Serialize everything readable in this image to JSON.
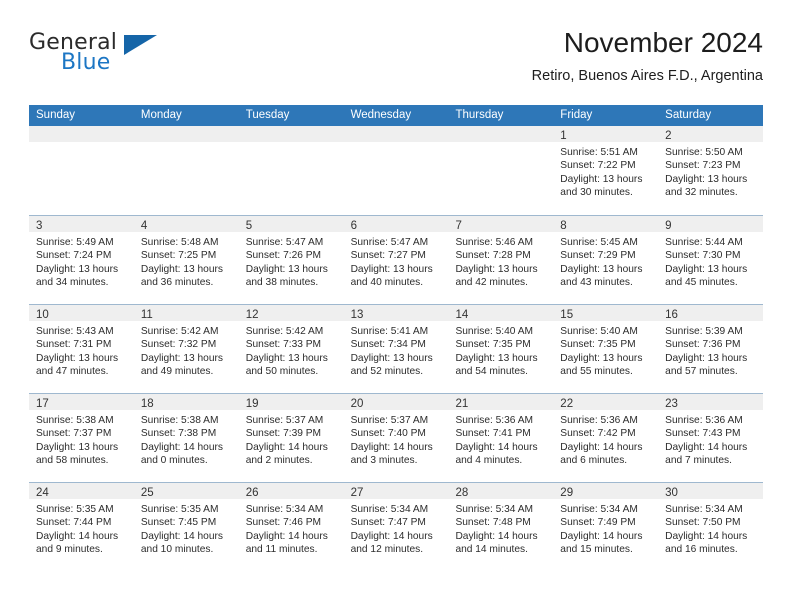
{
  "brand": {
    "name_top": "General",
    "name_bottom": "Blue",
    "accent_color": "#1c76c4",
    "triangle_color": "#1565a8"
  },
  "header": {
    "title": "November 2024",
    "subtitle": "Retiro, Buenos Aires F.D., Argentina"
  },
  "calendar": {
    "header_bg": "#2e77b8",
    "daynum_bg": "#efefef",
    "weekdays": [
      "Sunday",
      "Monday",
      "Tuesday",
      "Wednesday",
      "Thursday",
      "Friday",
      "Saturday"
    ],
    "weeks": [
      [
        {
          "day": "",
          "empty": true
        },
        {
          "day": "",
          "empty": true
        },
        {
          "day": "",
          "empty": true
        },
        {
          "day": "",
          "empty": true
        },
        {
          "day": "",
          "empty": true
        },
        {
          "day": "1",
          "sunrise": "Sunrise: 5:51 AM",
          "sunset": "Sunset: 7:22 PM",
          "daylight1": "Daylight: 13 hours",
          "daylight2": "and 30 minutes."
        },
        {
          "day": "2",
          "sunrise": "Sunrise: 5:50 AM",
          "sunset": "Sunset: 7:23 PM",
          "daylight1": "Daylight: 13 hours",
          "daylight2": "and 32 minutes."
        }
      ],
      [
        {
          "day": "3",
          "sunrise": "Sunrise: 5:49 AM",
          "sunset": "Sunset: 7:24 PM",
          "daylight1": "Daylight: 13 hours",
          "daylight2": "and 34 minutes."
        },
        {
          "day": "4",
          "sunrise": "Sunrise: 5:48 AM",
          "sunset": "Sunset: 7:25 PM",
          "daylight1": "Daylight: 13 hours",
          "daylight2": "and 36 minutes."
        },
        {
          "day": "5",
          "sunrise": "Sunrise: 5:47 AM",
          "sunset": "Sunset: 7:26 PM",
          "daylight1": "Daylight: 13 hours",
          "daylight2": "and 38 minutes."
        },
        {
          "day": "6",
          "sunrise": "Sunrise: 5:47 AM",
          "sunset": "Sunset: 7:27 PM",
          "daylight1": "Daylight: 13 hours",
          "daylight2": "and 40 minutes."
        },
        {
          "day": "7",
          "sunrise": "Sunrise: 5:46 AM",
          "sunset": "Sunset: 7:28 PM",
          "daylight1": "Daylight: 13 hours",
          "daylight2": "and 42 minutes."
        },
        {
          "day": "8",
          "sunrise": "Sunrise: 5:45 AM",
          "sunset": "Sunset: 7:29 PM",
          "daylight1": "Daylight: 13 hours",
          "daylight2": "and 43 minutes."
        },
        {
          "day": "9",
          "sunrise": "Sunrise: 5:44 AM",
          "sunset": "Sunset: 7:30 PM",
          "daylight1": "Daylight: 13 hours",
          "daylight2": "and 45 minutes."
        }
      ],
      [
        {
          "day": "10",
          "sunrise": "Sunrise: 5:43 AM",
          "sunset": "Sunset: 7:31 PM",
          "daylight1": "Daylight: 13 hours",
          "daylight2": "and 47 minutes."
        },
        {
          "day": "11",
          "sunrise": "Sunrise: 5:42 AM",
          "sunset": "Sunset: 7:32 PM",
          "daylight1": "Daylight: 13 hours",
          "daylight2": "and 49 minutes."
        },
        {
          "day": "12",
          "sunrise": "Sunrise: 5:42 AM",
          "sunset": "Sunset: 7:33 PM",
          "daylight1": "Daylight: 13 hours",
          "daylight2": "and 50 minutes."
        },
        {
          "day": "13",
          "sunrise": "Sunrise: 5:41 AM",
          "sunset": "Sunset: 7:34 PM",
          "daylight1": "Daylight: 13 hours",
          "daylight2": "and 52 minutes."
        },
        {
          "day": "14",
          "sunrise": "Sunrise: 5:40 AM",
          "sunset": "Sunset: 7:35 PM",
          "daylight1": "Daylight: 13 hours",
          "daylight2": "and 54 minutes."
        },
        {
          "day": "15",
          "sunrise": "Sunrise: 5:40 AM",
          "sunset": "Sunset: 7:35 PM",
          "daylight1": "Daylight: 13 hours",
          "daylight2": "and 55 minutes."
        },
        {
          "day": "16",
          "sunrise": "Sunrise: 5:39 AM",
          "sunset": "Sunset: 7:36 PM",
          "daylight1": "Daylight: 13 hours",
          "daylight2": "and 57 minutes."
        }
      ],
      [
        {
          "day": "17",
          "sunrise": "Sunrise: 5:38 AM",
          "sunset": "Sunset: 7:37 PM",
          "daylight1": "Daylight: 13 hours",
          "daylight2": "and 58 minutes."
        },
        {
          "day": "18",
          "sunrise": "Sunrise: 5:38 AM",
          "sunset": "Sunset: 7:38 PM",
          "daylight1": "Daylight: 14 hours",
          "daylight2": "and 0 minutes."
        },
        {
          "day": "19",
          "sunrise": "Sunrise: 5:37 AM",
          "sunset": "Sunset: 7:39 PM",
          "daylight1": "Daylight: 14 hours",
          "daylight2": "and 2 minutes."
        },
        {
          "day": "20",
          "sunrise": "Sunrise: 5:37 AM",
          "sunset": "Sunset: 7:40 PM",
          "daylight1": "Daylight: 14 hours",
          "daylight2": "and 3 minutes."
        },
        {
          "day": "21",
          "sunrise": "Sunrise: 5:36 AM",
          "sunset": "Sunset: 7:41 PM",
          "daylight1": "Daylight: 14 hours",
          "daylight2": "and 4 minutes."
        },
        {
          "day": "22",
          "sunrise": "Sunrise: 5:36 AM",
          "sunset": "Sunset: 7:42 PM",
          "daylight1": "Daylight: 14 hours",
          "daylight2": "and 6 minutes."
        },
        {
          "day": "23",
          "sunrise": "Sunrise: 5:36 AM",
          "sunset": "Sunset: 7:43 PM",
          "daylight1": "Daylight: 14 hours",
          "daylight2": "and 7 minutes."
        }
      ],
      [
        {
          "day": "24",
          "sunrise": "Sunrise: 5:35 AM",
          "sunset": "Sunset: 7:44 PM",
          "daylight1": "Daylight: 14 hours",
          "daylight2": "and 9 minutes."
        },
        {
          "day": "25",
          "sunrise": "Sunrise: 5:35 AM",
          "sunset": "Sunset: 7:45 PM",
          "daylight1": "Daylight: 14 hours",
          "daylight2": "and 10 minutes."
        },
        {
          "day": "26",
          "sunrise": "Sunrise: 5:34 AM",
          "sunset": "Sunset: 7:46 PM",
          "daylight1": "Daylight: 14 hours",
          "daylight2": "and 11 minutes."
        },
        {
          "day": "27",
          "sunrise": "Sunrise: 5:34 AM",
          "sunset": "Sunset: 7:47 PM",
          "daylight1": "Daylight: 14 hours",
          "daylight2": "and 12 minutes."
        },
        {
          "day": "28",
          "sunrise": "Sunrise: 5:34 AM",
          "sunset": "Sunset: 7:48 PM",
          "daylight1": "Daylight: 14 hours",
          "daylight2": "and 14 minutes."
        },
        {
          "day": "29",
          "sunrise": "Sunrise: 5:34 AM",
          "sunset": "Sunset: 7:49 PM",
          "daylight1": "Daylight: 14 hours",
          "daylight2": "and 15 minutes."
        },
        {
          "day": "30",
          "sunrise": "Sunrise: 5:34 AM",
          "sunset": "Sunset: 7:50 PM",
          "daylight1": "Daylight: 14 hours",
          "daylight2": "and 16 minutes."
        }
      ]
    ]
  }
}
